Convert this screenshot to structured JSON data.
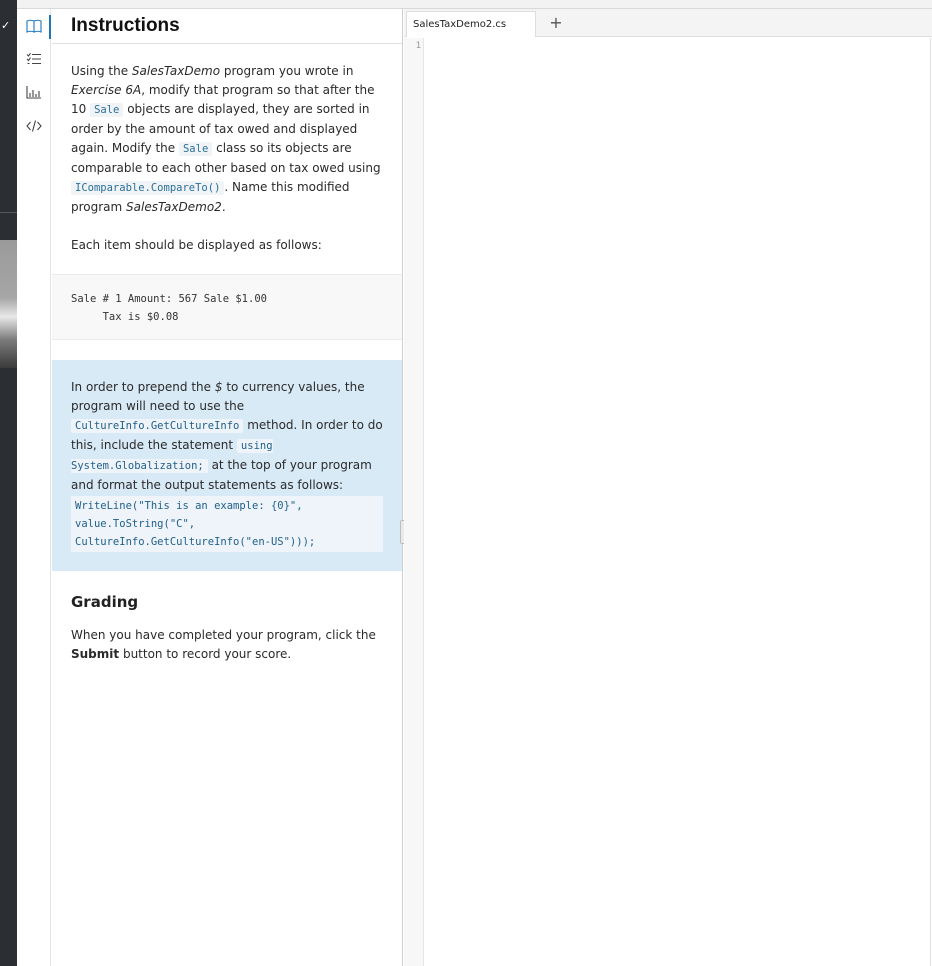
{
  "left_rail": {
    "check_glyph": "✓"
  },
  "sidebar": {
    "items": [
      {
        "name": "book-icon",
        "active": true
      },
      {
        "name": "checklist-icon",
        "active": false
      },
      {
        "name": "bar-chart-icon",
        "active": false
      },
      {
        "name": "code-icon",
        "active": false
      }
    ]
  },
  "instructions": {
    "title": "Instructions",
    "p1": {
      "t1": "Using the ",
      "em1": "SalesTaxDemo",
      "t2": " program you wrote in ",
      "em2": "Exercise 6A",
      "t3": ", modify that program so that after the 10 ",
      "code1": "Sale",
      "t4": " objects are displayed, they are sorted in order by the amount of tax owed and displayed again. Modify the ",
      "code2": "Sale",
      "t5": " class so its objects are comparable to each other based on tax owed using ",
      "code3": "IComparable.CompareTo()",
      "t6": ". Name this modified program ",
      "em3": "SalesTaxDemo2",
      "t7": "."
    },
    "p2": "Each item should be displayed as follows:",
    "example": {
      "line1": "Sale # 1 Amount: 567 Sale $1.00",
      "line2": "     Tax is $0.08"
    },
    "note": {
      "t1": "In order to prepend the ",
      "em1": "$",
      "t2": " to currency values, the program will need to use the ",
      "code1": "CultureInfo.GetCultureInfo",
      "t3": " method. In order to do this, include the statement ",
      "code2": "using System.Globalization;",
      "t4": " at the top of your program and format the output statements as follows:",
      "code_line1": "WriteLine(\"This is an example: {0}\",",
      "code_line2": "value.ToString(\"C\",",
      "code_line3": "CultureInfo.GetCultureInfo(\"en-US\")));"
    },
    "grading": {
      "title": "Grading",
      "t1": "When you have completed your program, click the ",
      "strong": "Submit",
      "t2": " button to record your score."
    }
  },
  "editor": {
    "tab_label": "SalesTaxDemo2.cs",
    "add_tab_label": "+",
    "line_number": "1"
  },
  "colors": {
    "accent": "#1b75bc",
    "note_bg": "#d9eaf7",
    "rail_bg": "#2b2f33"
  }
}
